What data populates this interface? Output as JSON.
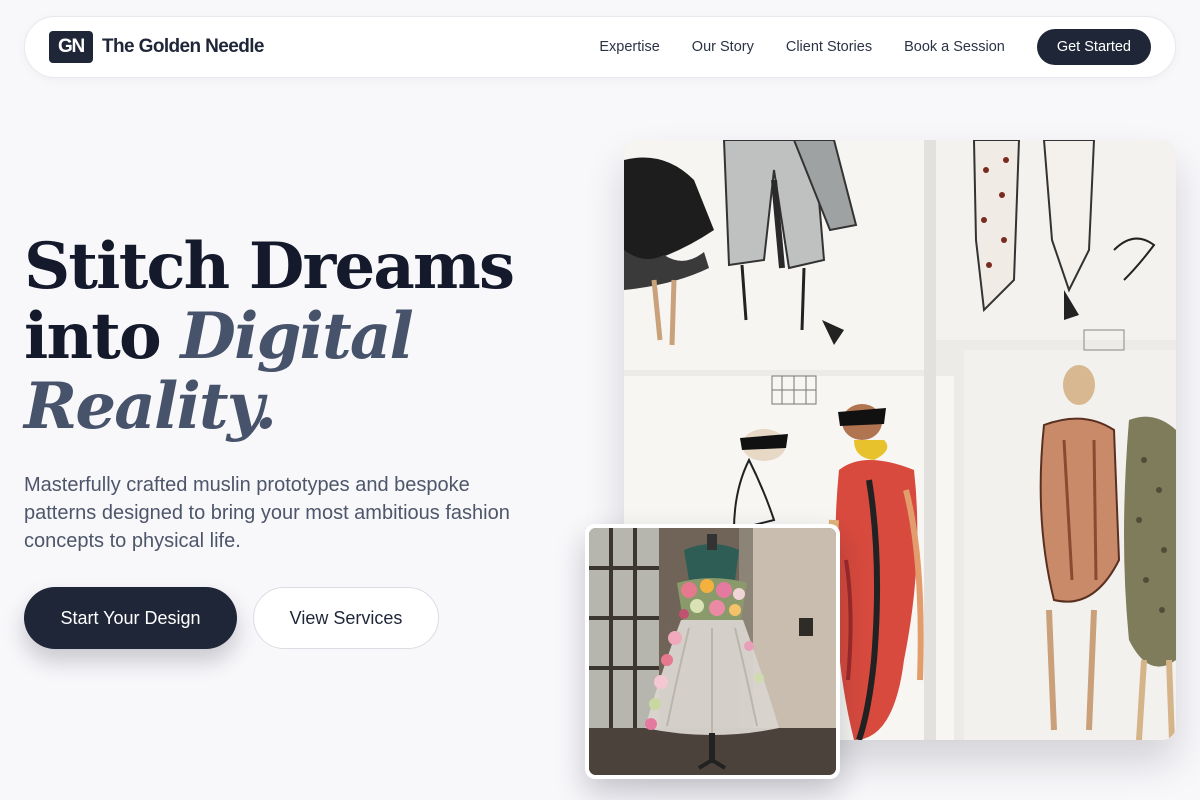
{
  "brand": {
    "mark": "GN",
    "name": "The Golden Needle"
  },
  "nav": {
    "links": [
      "Expertise",
      "Our Story",
      "Client Stories",
      "Book a Session"
    ],
    "cta": "Get Started"
  },
  "hero": {
    "title_line1": "Stitch Dreams",
    "title_line2_plain": "into",
    "title_line2_accent": "Digital",
    "title_line3_accent": "Reality.",
    "subtitle": "Masterfully crafted muslin prototypes and bespoke patterns designed to bring your most ambitious fashion concepts to physical life.",
    "primary_button": "Start Your Design",
    "secondary_button": "View Services"
  },
  "images": {
    "main_icon": "fashion-sketches-photo",
    "inset_icon": "floral-dress-form-photo"
  },
  "colors": {
    "primary": "#1e2638",
    "accent_text": "#46536a",
    "background": "#f8f7fa"
  }
}
